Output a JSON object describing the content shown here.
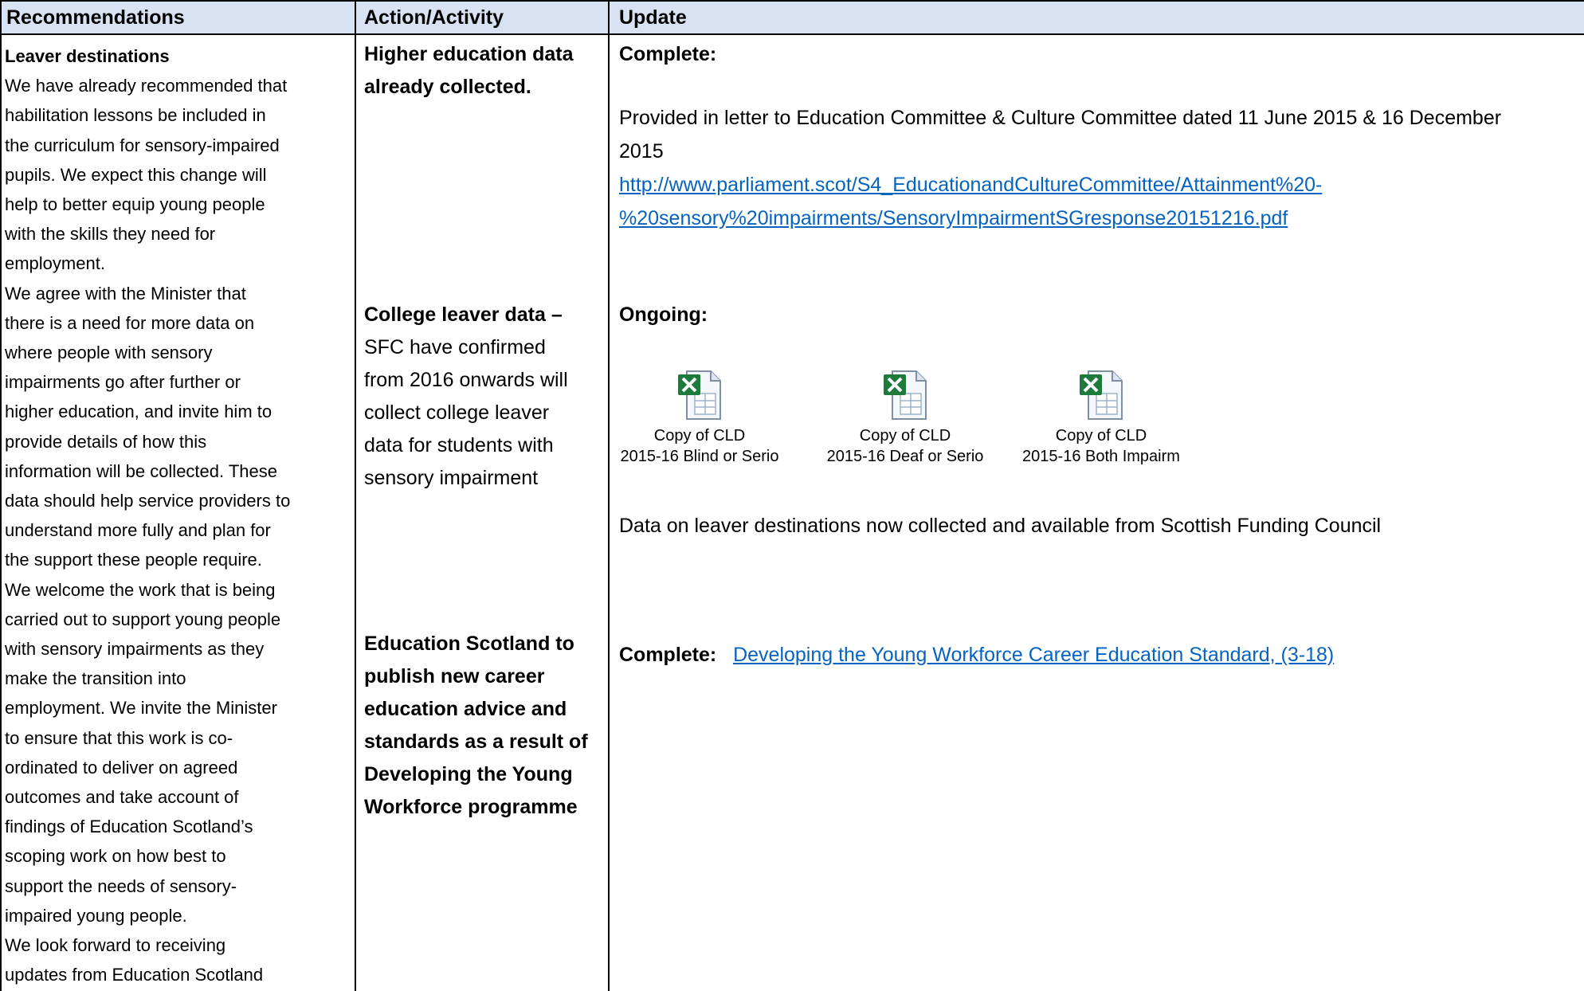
{
  "table": {
    "headers": [
      "Recommendations",
      "Action/Activity",
      "Update"
    ],
    "recommendations": {
      "heading": "Leaver destinations",
      "lines": [
        "We have already recommended that",
        "habilitation lessons be included in",
        "the curriculum for sensory-impaired",
        "pupils.  We expect this change will",
        "help to better equip young people",
        "with the skills they need for",
        "employment.",
        "We agree with the Minister that",
        "there is a need for more data on",
        "where people with sensory",
        "impairments go after further or",
        "higher education, and invite him to",
        "provide details of how this",
        "information will be collected.  These",
        "data should help service providers to",
        "understand more fully and plan for",
        "the support these people require.",
        "We welcome the work that is being",
        "carried out to support young people",
        "with sensory impairments as they",
        "make the transition into",
        "employment.  We invite the Minister",
        "to ensure that this work is co-",
        "ordinated to deliver on agreed",
        "outcomes and take account of",
        "findings of Education Scotland’s",
        "scoping work on how best to",
        "support the needs of sensory-",
        "impaired young people.",
        "We look forward to receiving",
        "updates from Education Scotland"
      ]
    },
    "actions": {
      "a1": [
        "Higher education data",
        "already collected."
      ],
      "a2_bold": "College leaver data –",
      "a2_lines": [
        "SFC have confirmed",
        "from 2016 onwards will",
        "collect college leaver",
        "data for students with",
        "sensory impairment"
      ],
      "a3": [
        "Education Scotland to",
        "publish new career",
        "education advice and",
        "standards as a result of",
        "Developing the Young",
        "Workforce programme"
      ]
    },
    "updates": {
      "u1_status": "Complete:",
      "u1_line1": "Provided in letter to Education Committee & Culture Committee dated 11 June 2015 & 16 December",
      "u1_line2": "2015",
      "u1_link1": "http://www.parliament.scot/S4_EducationandCultureCommittee/Attainment%20-",
      "u1_link2": "%20sensory%20impairments/SensoryImpairmentSGresponse20151216.pdf",
      "u2_status": "Ongoing:",
      "files": [
        {
          "line1": "Copy of CLD",
          "line2": "2015-16 Blind or Serio",
          "icon": "excel-file-icon"
        },
        {
          "line1": "Copy of CLD",
          "line2": "2015-16 Deaf or Serio",
          "icon": "excel-file-icon"
        },
        {
          "line1": "Copy of CLD",
          "line2": "2015-16 Both Impairm",
          "icon": "excel-file-icon"
        }
      ],
      "u2_text": "Data on leaver destinations  now collected and available from Scottish Funding Council",
      "u3_status": "Complete:",
      "u3_link": "Developing the Young Workforce Career Education Standard, (3-18)"
    }
  },
  "colors": {
    "header_bg": "#d9e2f3",
    "link": "#0563c1",
    "excel_green": "#1d7a3a"
  }
}
